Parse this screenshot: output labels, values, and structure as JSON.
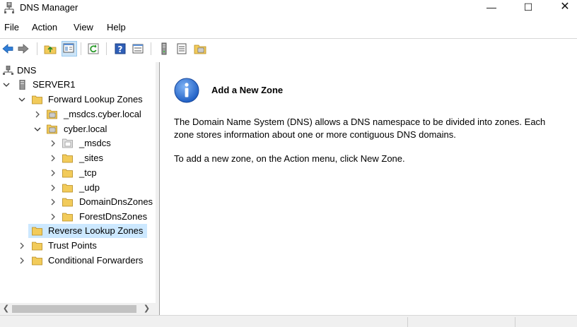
{
  "window": {
    "title": "DNS Manager",
    "controls": {
      "minimize": "—",
      "maximize": "☐",
      "close": "✕"
    }
  },
  "menu": [
    "File",
    "Action",
    "View",
    "Help"
  ],
  "toolbar": {
    "buttons": [
      "back-icon",
      "forward-icon",
      "up-folder-icon",
      "show-hide-tree-icon",
      "refresh-icon",
      "help-icon",
      "properties-icon",
      "server-icon",
      "list-icon",
      "zone-icon"
    ]
  },
  "tree": {
    "root": "DNS",
    "server": "SERVER1",
    "forward_zones": "Forward Lookup Zones",
    "msdcs_zone": "_msdcs.cyber.local",
    "cyber_zone": "cyber.local",
    "children": [
      "_msdcs",
      "_sites",
      "_tcp",
      "_udp",
      "DomainDnsZones",
      "ForestDnsZones"
    ],
    "reverse_zones": "Reverse Lookup Zones",
    "trust_points": "Trust Points",
    "conditional_forwarders": "Conditional Forwarders"
  },
  "content": {
    "heading": "Add a New Zone",
    "paragraph1_line1": "The Domain Name System (DNS) allows a DNS namespace to be divided into zones. Each",
    "paragraph1_line2": "zone stores information about one or more contiguous DNS domains.",
    "paragraph2": "To add a new zone, on the Action menu, click New Zone."
  },
  "colors": {
    "selection": "#cce8ff",
    "folder": "#f2cb5a",
    "info_blue": "#1f5fc4"
  }
}
